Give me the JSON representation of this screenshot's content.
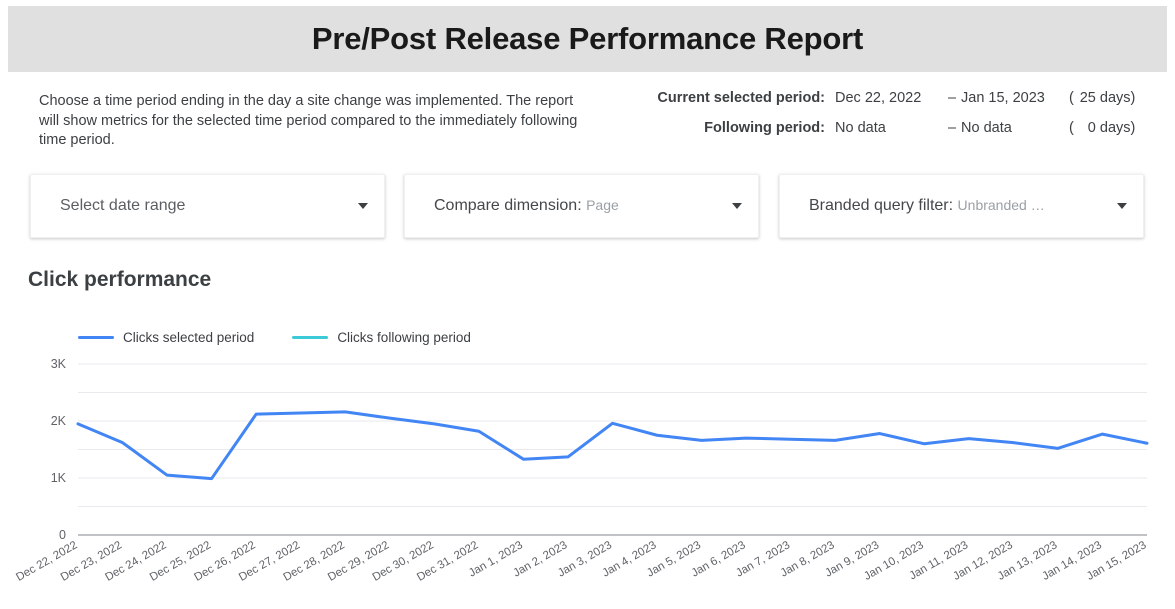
{
  "header": {
    "title": "Pre/Post Release Performance Report"
  },
  "info": {
    "instructions": "Choose a time period ending in the day a site change was implemented. The report will show metrics for the selected time period compared to the immediately following time period.",
    "periods": [
      {
        "label": "Current selected period:",
        "start": "Dec 22, 2022",
        "dash": "–",
        "end": "Jan 15, 2023",
        "open_paren": "(",
        "count": "25",
        "unit": "days",
        "close_paren": ")"
      },
      {
        "label": "Following period:",
        "start": "No data",
        "dash": "–",
        "end": "No data",
        "open_paren": "(",
        "count": "0",
        "unit": "days",
        "close_paren": ")"
      }
    ]
  },
  "controls": [
    {
      "label": "Select date range",
      "value": "",
      "separator": ""
    },
    {
      "label": "Compare dimension",
      "value": "Page",
      "separator": ":"
    },
    {
      "label": "Branded query filter",
      "value": "Unbranded …",
      "separator": ":"
    }
  ],
  "chart_section": {
    "heading": "Click performance"
  },
  "chart_data": {
    "type": "line",
    "title": "Click performance",
    "xlabel": "",
    "ylabel": "",
    "ylim": [
      0,
      3000
    ],
    "yticks": [
      0,
      1000,
      2000,
      3000
    ],
    "ytick_labels": [
      "0",
      "1K",
      "2K",
      "3K"
    ],
    "grid": true,
    "minor_gridlines": [
      500,
      1500,
      2500
    ],
    "legend_position": "top-left",
    "colors": {
      "selected_period": "#4285f4",
      "following_period": "#3dcad8",
      "gridline": "#e8eaed",
      "axis": "#80868b"
    },
    "x": [
      "Dec 22, 2022",
      "Dec 23, 2022",
      "Dec 24, 2022",
      "Dec 25, 2022",
      "Dec 26, 2022",
      "Dec 27, 2022",
      "Dec 28, 2022",
      "Dec 29, 2022",
      "Dec 30, 2022",
      "Dec 31, 2022",
      "Jan 1, 2023",
      "Jan 2, 2023",
      "Jan 3, 2023",
      "Jan 4, 2023",
      "Jan 5, 2023",
      "Jan 6, 2023",
      "Jan 7, 2023",
      "Jan 8, 2023",
      "Jan 9, 2023",
      "Jan 10, 2023",
      "Jan 11, 2023",
      "Jan 12, 2023",
      "Jan 13, 2023",
      "Jan 14, 2023",
      "Jan 15, 2023"
    ],
    "series": [
      {
        "name": "Clicks selected period",
        "color": "#4285f4",
        "values": [
          1950,
          1620,
          1050,
          990,
          2120,
          2140,
          2160,
          2050,
          1950,
          1820,
          1330,
          1370,
          1960,
          1750,
          1660,
          1700,
          1680,
          1660,
          1780,
          1600,
          1690,
          1620,
          1520,
          1770,
          1610
        ]
      },
      {
        "name": "Clicks following period",
        "color": "#3dcad8",
        "values": []
      }
    ]
  }
}
